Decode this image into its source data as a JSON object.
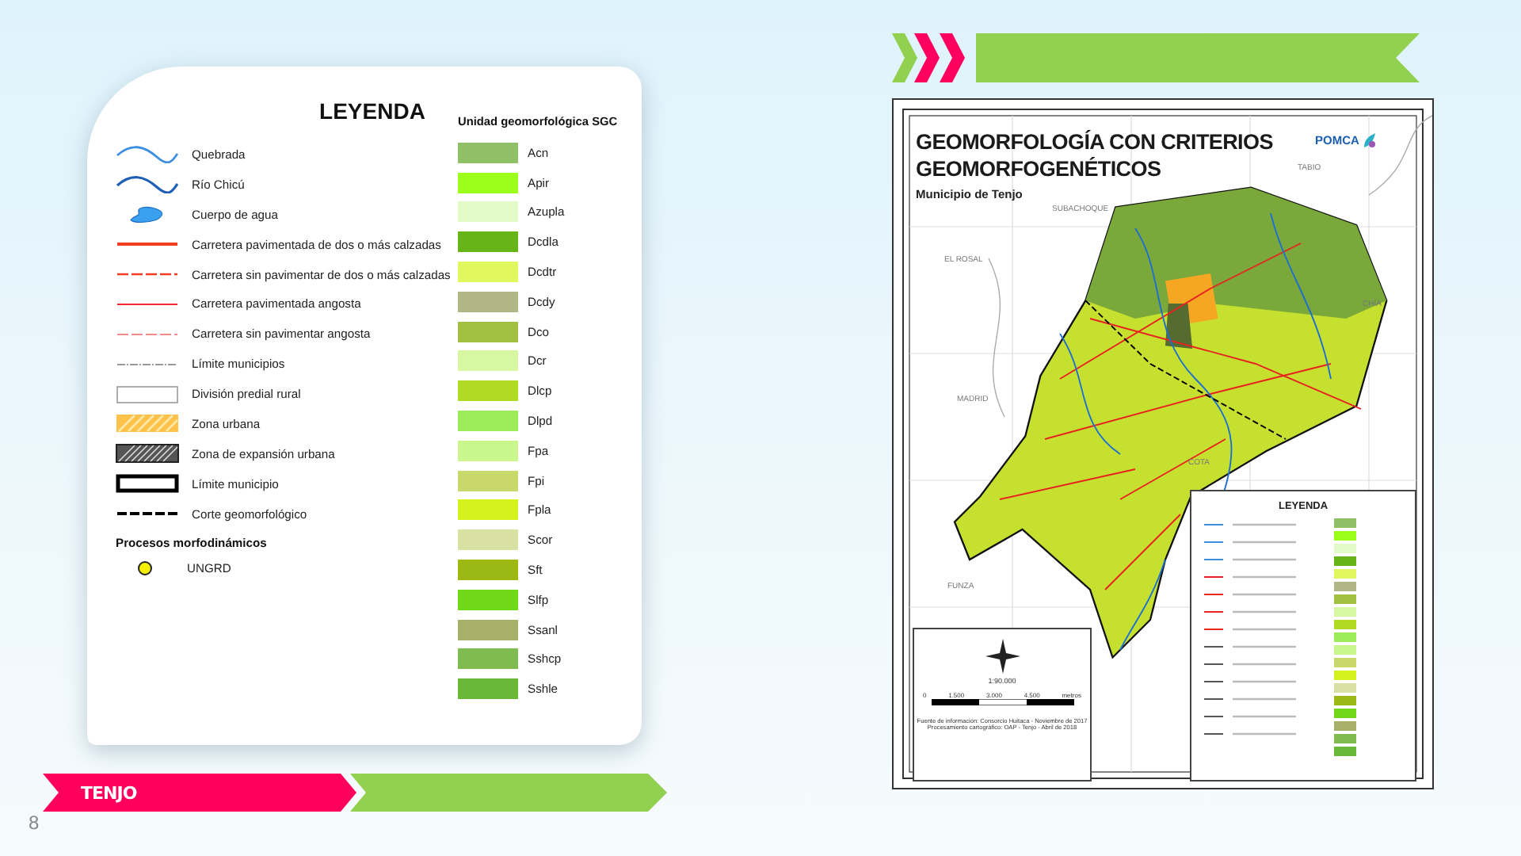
{
  "legend": {
    "title": "LEYENDA",
    "symbols": [
      {
        "kind": "stream",
        "label": "Quebrada"
      },
      {
        "kind": "river",
        "label": "Río Chicú"
      },
      {
        "kind": "water",
        "label": "Cuerpo de agua"
      },
      {
        "kind": "road-main",
        "label": "Carretera pavimentada de dos o más calzadas"
      },
      {
        "kind": "road-main-dashed",
        "label": "Carretera sin pavimentar de dos o más calzadas"
      },
      {
        "kind": "road-narrow",
        "label": "Carretera pavimentada angosta"
      },
      {
        "kind": "road-narrow-dashed",
        "label": "Carretera sin pavimentar angosta"
      },
      {
        "kind": "dotted",
        "label": "Límite municipios"
      },
      {
        "kind": "plain-box",
        "label": "División predial rural"
      },
      {
        "kind": "urban-hatch",
        "label": "Zona urbana"
      },
      {
        "kind": "expansion-hatch",
        "label": "Zona de expansión urbana"
      },
      {
        "kind": "thick-box",
        "label": "Límite municipio"
      },
      {
        "kind": "cut-line",
        "label": "Corte geomorfológico"
      }
    ],
    "processes": {
      "title": "Procesos morfodinámicos",
      "items": [
        {
          "label": "UNGRD",
          "color": "#f5f000"
        }
      ]
    },
    "units_title": "Unidad geomorfológica SGC",
    "units": [
      {
        "label": "Acn",
        "color": "#8fbf67"
      },
      {
        "label": "Apir",
        "color": "#9cff1a"
      },
      {
        "label": "Azupla",
        "color": "#e3fbc8"
      },
      {
        "label": "Dcdla",
        "color": "#66b418"
      },
      {
        "label": "Dcdtr",
        "color": "#e0f85e"
      },
      {
        "label": "Dcdy",
        "color": "#b0b686"
      },
      {
        "label": "Dco",
        "color": "#a2c040"
      },
      {
        "label": "Dcr",
        "color": "#d8f7a3"
      },
      {
        "label": "Dlcp",
        "color": "#b0da24"
      },
      {
        "label": "Dlpd",
        "color": "#9ceb58"
      },
      {
        "label": "Fpa",
        "color": "#caf78b"
      },
      {
        "label": "Fpi",
        "color": "#c8d86a"
      },
      {
        "label": "Fpla",
        "color": "#d6f21e"
      },
      {
        "label": "Scor",
        "color": "#d8e0a2"
      },
      {
        "label": "Sft",
        "color": "#9cb814"
      },
      {
        "label": "Slfp",
        "color": "#70d818"
      },
      {
        "label": "Ssanl",
        "color": "#a6b068"
      },
      {
        "label": "Sshcp",
        "color": "#7fbb4f"
      },
      {
        "label": "Sshle",
        "color": "#6ab838"
      }
    ]
  },
  "map": {
    "title_lines": [
      "GEOMORFOLOGÍA CON CRITERIOS",
      "GEOMORFOGENÉTICOS"
    ],
    "subtitle": "Municipio de Tenjo",
    "logo": "POMCA",
    "places": [
      "TABIO",
      "SUBACHOQUE",
      "EL ROSAL",
      "CHÍA",
      "MADRID",
      "COTA",
      "FUNZA"
    ],
    "legend_title": "LEYENDA",
    "scale": "1:90.000",
    "scale_ticks": [
      "0",
      "1.500",
      "3.000",
      "4.500"
    ],
    "scale_unit": "metros",
    "source_lines": [
      "Fuente de información: Consorcio Huitaca - Noviembre de 2017",
      "Procesamiento cartográfico: OAP - Tenjo - Abril de 2018"
    ]
  },
  "footer": {
    "brand": "TENJO",
    "page": "8"
  }
}
